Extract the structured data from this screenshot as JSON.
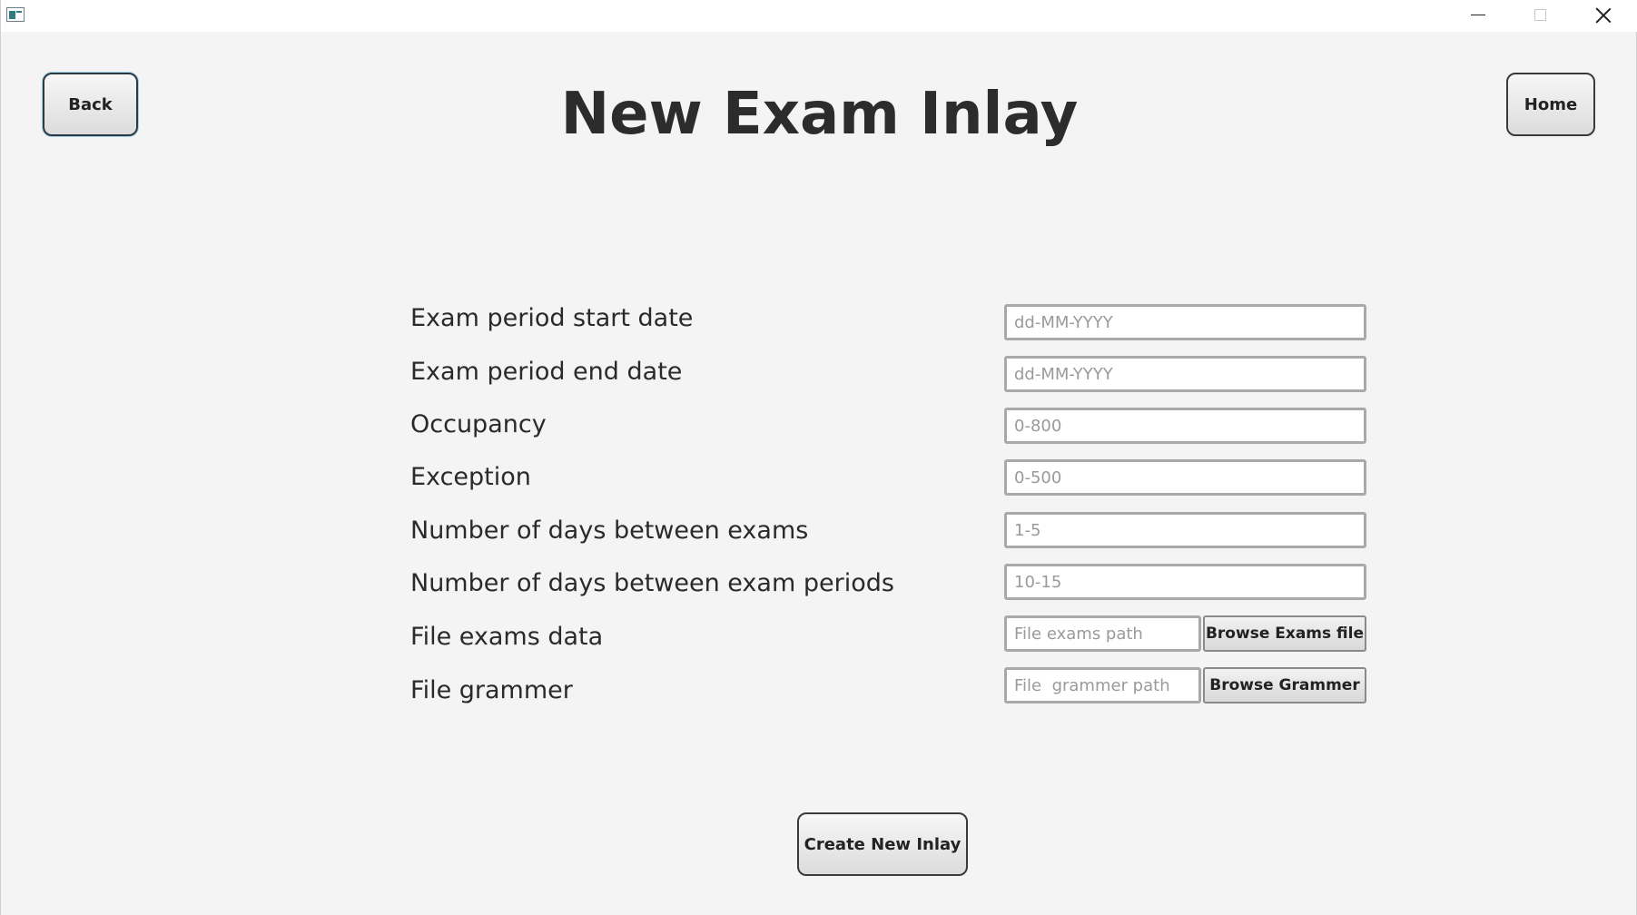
{
  "window": {
    "icon": "app-window-icon",
    "controls": {
      "minimize_icon": "minimize-icon",
      "maximize_icon": "maximize-icon",
      "close_icon": "close-icon"
    }
  },
  "header": {
    "back_label": "Back",
    "title": "New Exam Inlay",
    "home_label": "Home"
  },
  "form": {
    "start_date": {
      "label": "Exam period start date",
      "placeholder": "dd-MM-YYYY",
      "value": ""
    },
    "end_date": {
      "label": "Exam period end date",
      "placeholder": "dd-MM-YYYY",
      "value": ""
    },
    "occupancy": {
      "label": "Occupancy",
      "placeholder": "0-800",
      "value": ""
    },
    "exception": {
      "label": "Exception",
      "placeholder": "0-500",
      "value": ""
    },
    "days_between_exams": {
      "label": "Number of days between exams",
      "placeholder": "1-5",
      "value": ""
    },
    "days_between_periods": {
      "label": "Number of days between exam periods",
      "placeholder": "10-15",
      "value": ""
    },
    "exams_file": {
      "label": "File exams data",
      "placeholder": "File exams path",
      "value": "",
      "browse_label": "Browse Exams file"
    },
    "grammar_file": {
      "label": "File grammer",
      "placeholder": "File  grammer path",
      "value": "",
      "browse_label": "Browse Grammer"
    }
  },
  "footer": {
    "create_label": "Create New Inlay"
  },
  "colors": {
    "background": "#f4f4f4",
    "title_text": "#2c2c2c",
    "input_border": "#a9a9a9",
    "button_border": "#3a3a3a"
  }
}
